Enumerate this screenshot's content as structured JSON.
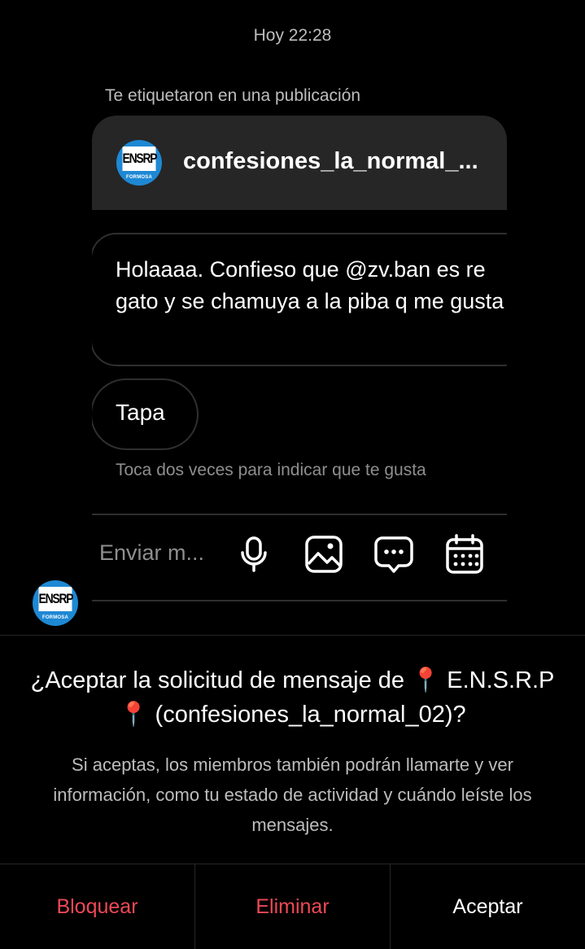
{
  "timestamp": "Hoy 22:28",
  "tagged_label": "Te etiquetaron en una publicación",
  "post": {
    "account_name": "confesiones_la_normal_...",
    "logo_text": "ENSRP",
    "logo_subtext": "FORMOSA"
  },
  "messages": [
    {
      "text": "Holaaaa. Confieso que @zv.ban es re gato y se chamuya a la piba q me gusta"
    },
    {
      "text": "Tapa"
    }
  ],
  "hint": "Toca dos veces para indicar que te gusta",
  "composer": {
    "placeholder": "Enviar m...",
    "icons": [
      "microphone-icon",
      "image-icon",
      "chat-bubble-icon",
      "calendar-icon"
    ]
  },
  "request": {
    "title": "¿Aceptar la solicitud de mensaje de 📍 E.N.S.R.P📍 (confesiones_la_normal_02)?",
    "description": "Si aceptas, los miembros también podrán llamarte y ver información, como tu estado de actividad y cuándo leíste los mensajes."
  },
  "actions": {
    "block": "Bloquear",
    "delete": "Eliminar",
    "accept": "Aceptar"
  },
  "colors": {
    "background": "#000000",
    "card_header": "#262626",
    "danger": "#ed4956",
    "muted_text": "#8e8e8e"
  }
}
